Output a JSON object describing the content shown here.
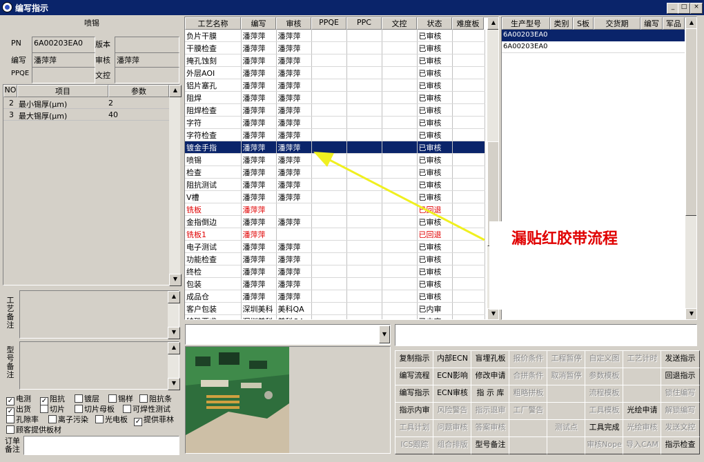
{
  "window": {
    "title": "编写指示",
    "controls": [
      "_",
      "□",
      "×"
    ]
  },
  "header": {
    "section_title": "喷锡",
    "pn_label": "PN",
    "pn_value": "6A00203EA0",
    "version_label": "版本",
    "version_value": "",
    "writer_label": "编写",
    "writer_value": "潘萍萍",
    "reviewer_label": "审核",
    "reviewer_value": "潘萍萍",
    "ppqe_label": "PPQE",
    "ppqe_value": "",
    "doc_ctrl_label": "文控",
    "doc_ctrl_value": ""
  },
  "params": {
    "columns": [
      "NO",
      "项目",
      "参数"
    ],
    "rows": [
      {
        "no": "2",
        "item": "最小锡厚(μm)",
        "value": "2"
      },
      {
        "no": "3",
        "item": "最大锡厚(μm)",
        "value": "40"
      }
    ]
  },
  "remarks": {
    "process_label": "工艺备注",
    "model_label": "型号备注",
    "order_label": "订单备注"
  },
  "checkboxes": [
    {
      "label": "电测",
      "checked": true
    },
    {
      "label": "阻抗",
      "checked": true
    },
    {
      "label": "镀层",
      "checked": false
    },
    {
      "label": "锡样",
      "checked": false
    },
    {
      "label": "阻抗条",
      "checked": false
    },
    {
      "label": "出货",
      "checked": true
    },
    {
      "label": "切片",
      "checked": false
    },
    {
      "label": "切片母板",
      "checked": false
    },
    {
      "label": "可焊性测试",
      "checked": false
    },
    {
      "label": "孔隙率",
      "checked": false
    },
    {
      "label": "离子污染",
      "checked": false
    },
    {
      "label": "光电板",
      "checked": false
    },
    {
      "label": "提供菲林",
      "checked": true
    },
    {
      "label": "顾客提供板材",
      "checked": false
    }
  ],
  "process": {
    "columns": [
      "工艺名称",
      "编写",
      "审核",
      "PPQE",
      "PPC",
      "文控",
      "状态",
      "难度板"
    ],
    "rows": [
      {
        "name": "负片干膜",
        "writer": "潘萍萍",
        "reviewer": "潘萍萍",
        "status": "已审核",
        "style": ""
      },
      {
        "name": "干膜检查",
        "writer": "潘萍萍",
        "reviewer": "潘萍萍",
        "status": "已审核",
        "style": ""
      },
      {
        "name": "掩孔蚀刻",
        "writer": "潘萍萍",
        "reviewer": "潘萍萍",
        "status": "已审核",
        "style": ""
      },
      {
        "name": "外层AOI",
        "writer": "潘萍萍",
        "reviewer": "潘萍萍",
        "status": "已审核",
        "style": ""
      },
      {
        "name": "铝片塞孔",
        "writer": "潘萍萍",
        "reviewer": "潘萍萍",
        "status": "已审核",
        "style": ""
      },
      {
        "name": "阻焊",
        "writer": "潘萍萍",
        "reviewer": "潘萍萍",
        "status": "已审核",
        "style": ""
      },
      {
        "name": "阻焊检查",
        "writer": "潘萍萍",
        "reviewer": "潘萍萍",
        "status": "已审核",
        "style": ""
      },
      {
        "name": "字符",
        "writer": "潘萍萍",
        "reviewer": "潘萍萍",
        "status": "已审核",
        "style": ""
      },
      {
        "name": "字符检查",
        "writer": "潘萍萍",
        "reviewer": "潘萍萍",
        "status": "已审核",
        "style": ""
      },
      {
        "name": "镀金手指",
        "writer": "潘萍萍",
        "reviewer": "潘萍萍",
        "status": "已审核",
        "style": "sel"
      },
      {
        "name": "喷锡",
        "writer": "潘萍萍",
        "reviewer": "潘萍萍",
        "status": "已审核",
        "style": ""
      },
      {
        "name": "检查",
        "writer": "潘萍萍",
        "reviewer": "潘萍萍",
        "status": "已审核",
        "style": ""
      },
      {
        "name": "阻抗测试",
        "writer": "潘萍萍",
        "reviewer": "潘萍萍",
        "status": "已审核",
        "style": ""
      },
      {
        "name": "V槽",
        "writer": "潘萍萍",
        "reviewer": "潘萍萍",
        "status": "已审核",
        "style": ""
      },
      {
        "name": "铣板",
        "writer": "潘萍萍",
        "reviewer": "",
        "status": "已回退",
        "style": "red"
      },
      {
        "name": "金指倒边",
        "writer": "潘萍萍",
        "reviewer": "潘萍萍",
        "status": "已审核",
        "style": ""
      },
      {
        "name": "铣板1",
        "writer": "潘萍萍",
        "reviewer": "",
        "status": "已回退",
        "style": "red"
      },
      {
        "name": "电子测试",
        "writer": "潘萍萍",
        "reviewer": "潘萍萍",
        "status": "已审核",
        "style": ""
      },
      {
        "name": "功能检查",
        "writer": "潘萍萍",
        "reviewer": "潘萍萍",
        "status": "已审核",
        "style": ""
      },
      {
        "name": "终检",
        "writer": "潘萍萍",
        "reviewer": "潘萍萍",
        "status": "已审核",
        "style": ""
      },
      {
        "name": "包装",
        "writer": "潘萍萍",
        "reviewer": "潘萍萍",
        "status": "已审核",
        "style": ""
      },
      {
        "name": "成品仓",
        "writer": "潘萍萍",
        "reviewer": "潘萍萍",
        "status": "已审核",
        "style": ""
      },
      {
        "name": "客户包装",
        "writer": "深圳美科",
        "reviewer": "美科QA",
        "status": "已内审",
        "style": ""
      },
      {
        "name": "特殊要求",
        "writer": "深圳美科",
        "reviewer": "美科QA",
        "status": "已内审",
        "style": ""
      }
    ]
  },
  "models": {
    "columns": [
      "生产型号",
      "类别",
      "S板",
      "交货期",
      "编写",
      "军品"
    ],
    "rows": [
      {
        "model": "6A00203EA0",
        "selected": true
      },
      {
        "model": "6A00203EA0",
        "selected": false
      }
    ]
  },
  "annotation": {
    "text": "漏贴红胶带流程",
    "color": "#e00000",
    "arrow_color": "#f0f020"
  },
  "buttons": [
    [
      {
        "label": "复制指示",
        "enabled": true
      },
      {
        "label": "内部ECN",
        "enabled": true
      },
      {
        "label": "盲埋孔板",
        "enabled": true
      },
      {
        "label": "报价条件",
        "enabled": false
      },
      {
        "label": "工程暂停",
        "enabled": false
      },
      {
        "label": "自定义图",
        "enabled": false
      },
      {
        "label": "工艺计时",
        "enabled": false
      },
      {
        "label": "发送指示",
        "enabled": true
      }
    ],
    [
      {
        "label": "编写流程",
        "enabled": true
      },
      {
        "label": "ECN影响",
        "enabled": true
      },
      {
        "label": "修改申请",
        "enabled": true
      },
      {
        "label": "合拼条件",
        "enabled": false
      },
      {
        "label": "取消暂停",
        "enabled": false
      },
      {
        "label": "参数模板",
        "enabled": false
      },
      {
        "label": "",
        "enabled": false
      },
      {
        "label": "回退指示",
        "enabled": true
      }
    ],
    [
      {
        "label": "编写指示",
        "enabled": true
      },
      {
        "label": "ECN审核",
        "enabled": true
      },
      {
        "label": "指 示 库",
        "enabled": true
      },
      {
        "label": "粗略拼板",
        "enabled": false
      },
      {
        "label": "",
        "enabled": false
      },
      {
        "label": "流程模板",
        "enabled": false
      },
      {
        "label": "",
        "enabled": false
      },
      {
        "label": "锁住编写",
        "enabled": false
      }
    ],
    [
      {
        "label": "指示内审",
        "enabled": true
      },
      {
        "label": "风险警告",
        "enabled": false
      },
      {
        "label": "指示退审",
        "enabled": false
      },
      {
        "label": "工厂警告",
        "enabled": false
      },
      {
        "label": "",
        "enabled": false
      },
      {
        "label": "工具模板",
        "enabled": false
      },
      {
        "label": "光绘申请",
        "enabled": true
      },
      {
        "label": "解锁编写",
        "enabled": false
      }
    ],
    [
      {
        "label": "工具计划",
        "enabled": false
      },
      {
        "label": "问题审核",
        "enabled": false
      },
      {
        "label": "答案审核",
        "enabled": false
      },
      {
        "label": "",
        "enabled": false
      },
      {
        "label": "测试点",
        "enabled": false
      },
      {
        "label": "工具完成",
        "enabled": true
      },
      {
        "label": "光绘审核",
        "enabled": false
      },
      {
        "label": "发送文控",
        "enabled": false
      }
    ],
    [
      {
        "label": "ICS跟踪",
        "enabled": false
      },
      {
        "label": "组合排版",
        "enabled": false
      },
      {
        "label": "型号备注",
        "enabled": true
      },
      {
        "label": "",
        "enabled": false
      },
      {
        "label": "",
        "enabled": false
      },
      {
        "label": "审核Nope",
        "enabled": false
      },
      {
        "label": "导入CAM",
        "enabled": false
      },
      {
        "label": "指示检查",
        "enabled": true
      }
    ]
  ],
  "icons": {
    "dropdown": "chevron-down-icon",
    "scroll_up": "arrow-up-icon",
    "scroll_down": "arrow-down-icon"
  }
}
